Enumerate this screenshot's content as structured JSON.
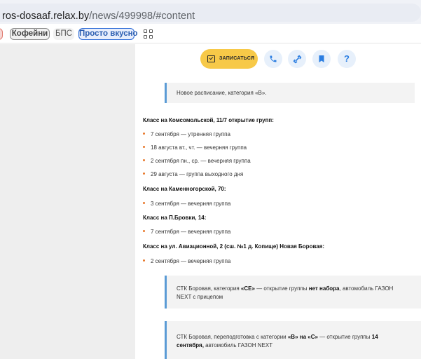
{
  "browser": {
    "url_host": "ros-dosaaf.relax.by",
    "url_path": "/news/499998/#content",
    "bookmarks": [
      {
        "label": ""
      },
      {
        "label": "Кофейни"
      },
      {
        "label": "БПС"
      },
      {
        "label": "Просто вкусно"
      }
    ]
  },
  "toolbar": {
    "enroll_label": "ЗАПИСАТЬСЯ",
    "help_glyph": "?"
  },
  "article": {
    "intro": "Новое расписание, категория «В».",
    "groups": [
      {
        "heading": "Класс на Комсомольской, 11/7 открытие групп:",
        "items": [
          "7 сентября — утренняя группа",
          "18 августа вт., чт. — вечерняя группа",
          "2 сентября пн., ср. — вечерняя группа",
          "29 августа — группа выходного дня"
        ]
      },
      {
        "heading": "Класс на Каменногорской, 70:",
        "items": [
          "3 сентября — вечерняя группа"
        ]
      },
      {
        "heading": "Класс на П.Бровки, 14:",
        "items": [
          "7 сентября — вечерняя группа"
        ]
      },
      {
        "heading": "Класс на ул. Авиационной, 2 (сш. №1 д. Копище) Новая Боровая:",
        "items": [
          "2 сентября — вечерняя группа"
        ]
      }
    ],
    "note1": {
      "p1": "СТК Боровая, категория ",
      "b1": "«СЕ»",
      "p2": " — открытие группы ",
      "b2": "нет набора",
      "p3": ", автомобиль ГАЗОН NEXT с прицепом"
    },
    "note2": {
      "p1": "СТК Боровая, переподготовка с категории ",
      "b1": "«В» на «С»",
      "p2": " — открытие группы ",
      "b2": "14 сентября,",
      "p3": " автомобиль ГАЗОН NEXT"
    }
  }
}
